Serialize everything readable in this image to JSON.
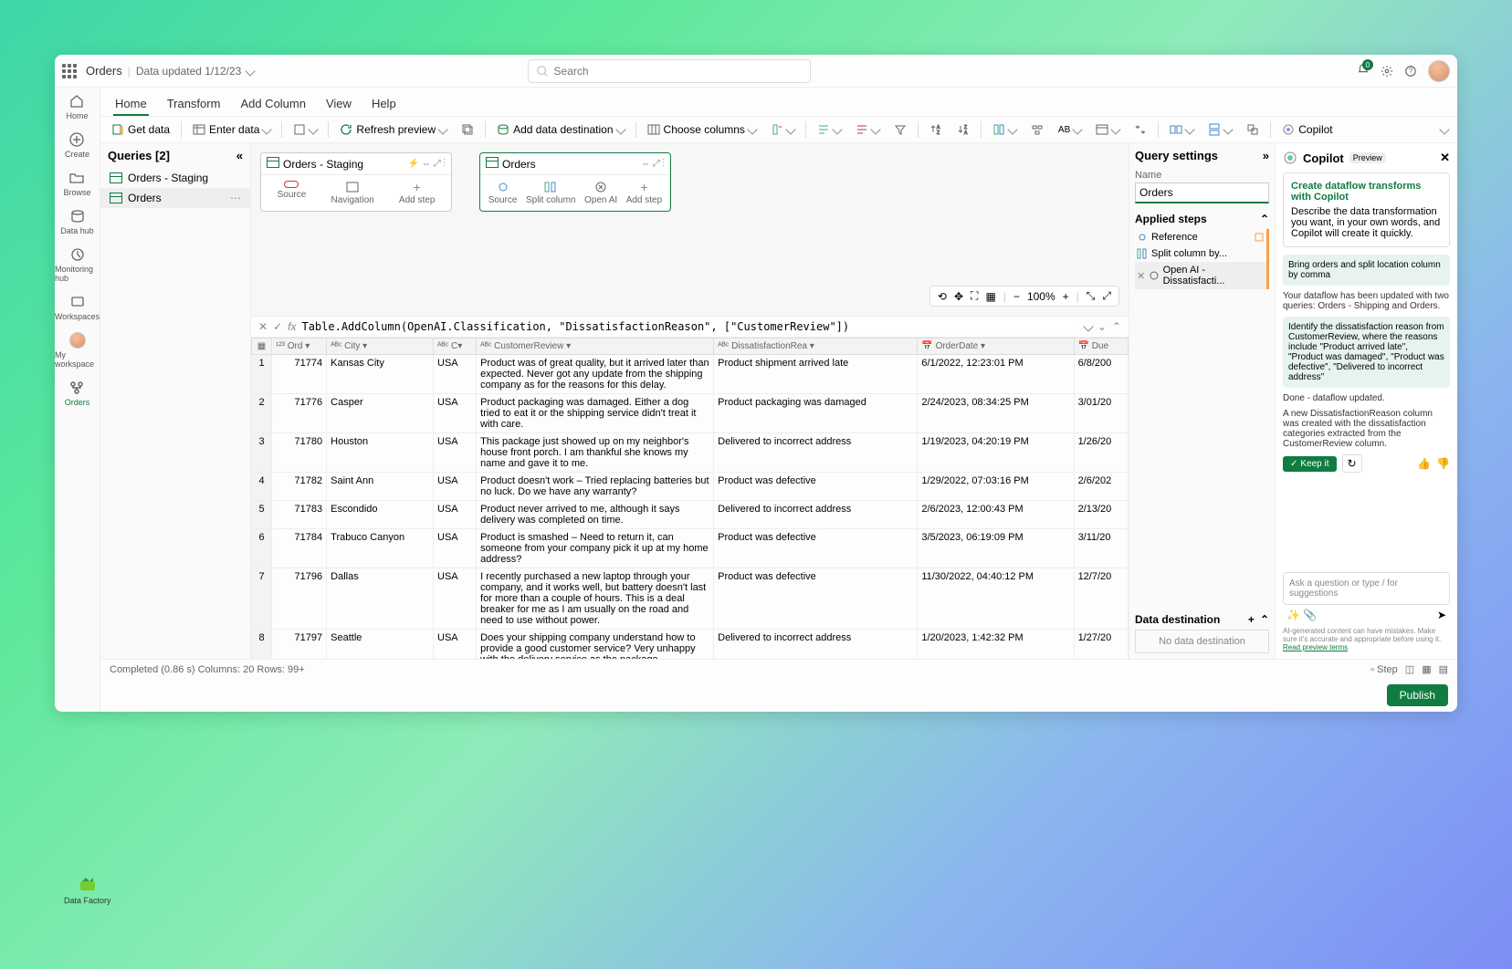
{
  "header": {
    "title": "Orders",
    "subtitle": "Data updated 1/12/23",
    "searchPlaceholder": "Search",
    "notifCount": "0"
  },
  "leftNav": [
    {
      "label": "Home",
      "name": "nav-home"
    },
    {
      "label": "Create",
      "name": "nav-create"
    },
    {
      "label": "Browse",
      "name": "nav-browse"
    },
    {
      "label": "Data hub",
      "name": "nav-datahub"
    },
    {
      "label": "Monitoring hub",
      "name": "nav-monitoring"
    },
    {
      "label": "Workspaces",
      "name": "nav-workspaces"
    },
    {
      "label": "My workspace",
      "name": "nav-myworkspace"
    },
    {
      "label": "Orders",
      "name": "nav-orders",
      "active": true
    }
  ],
  "tabs": [
    "Home",
    "Transform",
    "Add Column",
    "View",
    "Help"
  ],
  "ribbon": {
    "getData": "Get data",
    "enterData": "Enter data",
    "refresh": "Refresh preview",
    "addDest": "Add data destination",
    "chooseCols": "Choose columns",
    "copilot": "Copilot"
  },
  "queries": {
    "title": "Queries [2]",
    "items": [
      {
        "label": "Orders - Staging"
      },
      {
        "label": "Orders",
        "selected": true
      }
    ]
  },
  "diagram": {
    "card1": {
      "title": "Orders - Staging",
      "steps": [
        "Source",
        "Navigation",
        "Add step"
      ]
    },
    "card2": {
      "title": "Orders",
      "steps": [
        "Source",
        "Split column",
        "Open AI",
        "Add step"
      ]
    },
    "zoom": "100%"
  },
  "formula": "Table.AddColumn(OpenAI.Classification, \"DissatisfactionReason\", [\"CustomerReview\"])",
  "columns": [
    "",
    "Ord",
    "City",
    "C",
    "CustomerReview",
    "DissatisfactionRea",
    "OrderDate",
    "Due"
  ],
  "rows": [
    {
      "n": "1",
      "ord": "71774",
      "city": "Kansas City",
      "c": "USA",
      "review": "Product was of great quality, but it arrived later than expected. Never got any update from the shipping company as for the reasons for this delay.",
      "reason": "Product shipment arrived late",
      "date": "6/1/2022, 12:23:01 PM",
      "due": "6/8/200"
    },
    {
      "n": "2",
      "ord": "71776",
      "city": "Casper",
      "c": "USA",
      "review": "Product packaging was damaged. Either a dog tried to eat it or the shipping service didn't treat it with care.",
      "reason": "Product packaging was damaged",
      "date": "2/24/2023, 08:34:25 PM",
      "due": "3/01/20"
    },
    {
      "n": "3",
      "ord": "71780",
      "city": "Houston",
      "c": "USA",
      "review": "This package just showed up on my neighbor's house front porch. I am thankful she knows my name and gave it to me.",
      "reason": "Delivered to incorrect address",
      "date": "1/19/2023, 04:20:19 PM",
      "due": "1/26/20"
    },
    {
      "n": "4",
      "ord": "71782",
      "city": "Saint Ann",
      "c": "USA",
      "review": "Product doesn't work – Tried replacing batteries but no luck. Do we have any warranty?",
      "reason": "Product was defective",
      "date": "1/29/2022, 07:03:16 PM",
      "due": "2/6/202"
    },
    {
      "n": "5",
      "ord": "71783",
      "city": "Escondido",
      "c": "USA",
      "review": "Product never arrived to me, although it says delivery was completed on time.",
      "reason": "Delivered to incorrect address",
      "date": "2/6/2023, 12:00:43 PM",
      "due": "2/13/20"
    },
    {
      "n": "6",
      "ord": "71784",
      "city": "Trabuco Canyon",
      "c": "USA",
      "review": "Product is smashed – Need to return it, can someone from your company pick it up at my home address?",
      "reason": "Product was defective",
      "date": "3/5/2023, 06:19:09 PM",
      "due": "3/11/20"
    },
    {
      "n": "7",
      "ord": "71796",
      "city": "Dallas",
      "c": "USA",
      "review": "I recently purchased a new laptop through your company, and it works well, but battery doesn't last for more than a couple of hours. This is a deal breaker for me as I am usually on the road and need to use without power.",
      "reason": "Product was defective",
      "date": "11/30/2022, 04:40:12 PM",
      "due": "12/7/20"
    },
    {
      "n": "8",
      "ord": "71797",
      "city": "Seattle",
      "c": "USA",
      "review": "Does your shipping company understand how to provide a good customer service? Very unhappy with the delivery service as the package",
      "reason": "Delivered to incorrect address",
      "date": "1/20/2023, 1:42:32 PM",
      "due": "1/27/20"
    }
  ],
  "settings": {
    "title": "Query settings",
    "nameLabel": "Name",
    "name": "Orders",
    "stepsTitle": "Applied steps",
    "steps": [
      {
        "label": "Reference",
        "icon": "link"
      },
      {
        "label": "Split column by...",
        "icon": "split"
      },
      {
        "label": "Open AI - Dissatisfacti...",
        "icon": "ai",
        "selected": true
      }
    ],
    "destTitle": "Data destination",
    "destValue": "No data destination"
  },
  "copilot": {
    "title": "Copilot",
    "badge": "Preview",
    "infoTitle": "Create dataflow transforms with Copilot",
    "infoBody": "Describe the data transformation you want, in your own words, and Copilot will create it quickly.",
    "msg1": "Bring orders and split location column by comma",
    "resp1": "Your dataflow has been updated with two queries:  Orders - Shipping and Orders.",
    "msg2": "Identify the dissatisfaction reason from CustomerReview, where the reasons include \"Product arrived late\", \"Product was damaged\", \"Product was defective\", \"Delivered to incorrect address\"",
    "resp2a": "Done - dataflow updated.",
    "resp2b": "A new DissatisfactionReason column was created with the dissatisfaction categories extracted from the CustomerReview column.",
    "keepIt": "Keep it",
    "inputPlaceholder": "Ask a question or type / for suggestions",
    "legal": "AI-generated content can have mistakes. Make sure it's accurate and appropriate before using it.",
    "legalLink": "Read preview terms"
  },
  "footer": {
    "status": "Completed (0.86 s)   Columns: 20   Rows: 99+",
    "step": "Step",
    "publish": "Publish"
  },
  "dataFactory": "Data Factory"
}
